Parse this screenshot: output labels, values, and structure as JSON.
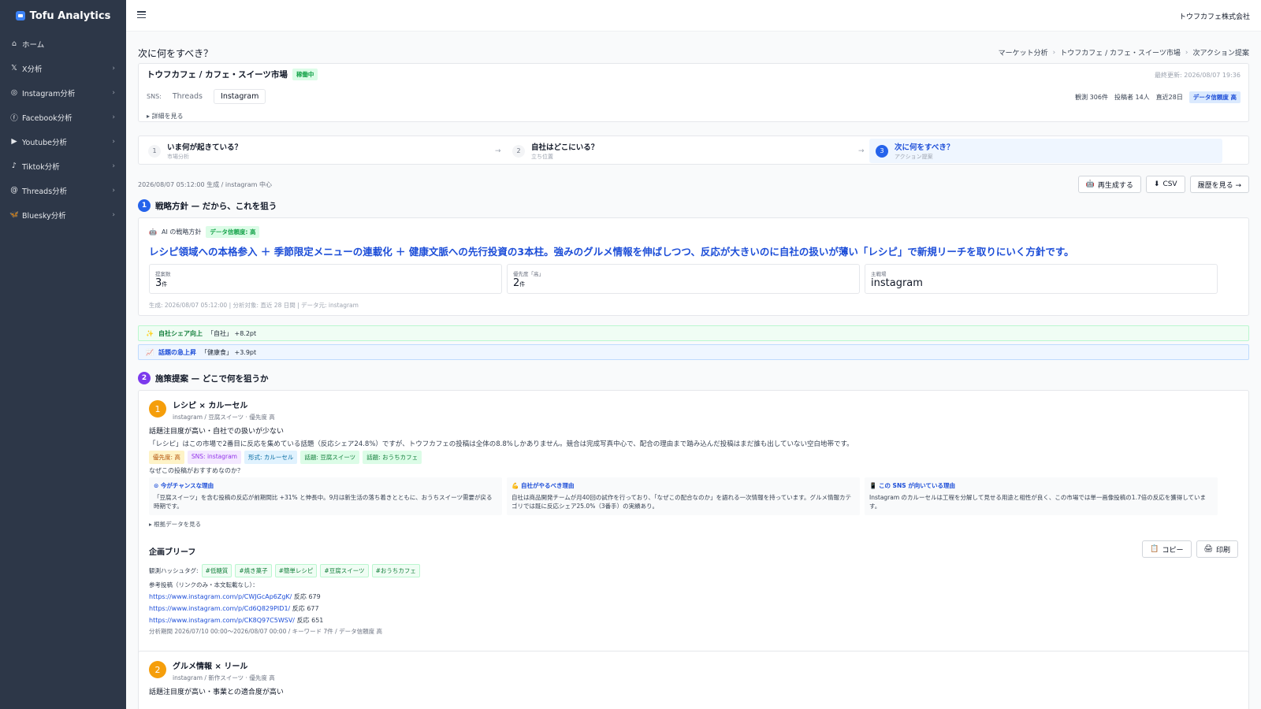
{
  "app": {
    "title": "Tofu Analytics",
    "company": "トウフカフェ株式会社"
  },
  "sidebar": {
    "items": [
      {
        "label": "ホーム",
        "icon": "home-icon",
        "chev": false
      },
      {
        "label": "X分析",
        "icon": "x-logo-icon",
        "chev": true
      },
      {
        "label": "Instagram分析",
        "icon": "instagram-icon",
        "chev": true
      },
      {
        "label": "Facebook分析",
        "icon": "facebook-icon",
        "chev": true
      },
      {
        "label": "Youtube分析",
        "icon": "youtube-icon",
        "chev": true
      },
      {
        "label": "Tiktok分析",
        "icon": "tiktok-icon",
        "chev": true
      },
      {
        "label": "Threads分析",
        "icon": "threads-icon",
        "chev": true
      },
      {
        "label": "Bluesky分析",
        "icon": "bluesky-icon",
        "chev": true
      }
    ]
  },
  "page": {
    "title": "次に何をすべき？",
    "breadcrumb": [
      "マーケット分析",
      "トウフカフェ / カフェ・スイーツ市場",
      "次アクション提案"
    ]
  },
  "market": {
    "title": "トウフカフェ / カフェ・スイーツ市場",
    "status": "稼働中",
    "last_update": "最終更新: 2026/08/07 19:36",
    "sns_label": "SNS:",
    "sns_tabs": [
      "Threads",
      "Instagram"
    ],
    "stats": [
      "観測 306件",
      "投稿者 14人",
      "直近28日"
    ],
    "reliability": "データ信頼度 高",
    "detail_toggle": "▸ 詳細を見る"
  },
  "steps": [
    {
      "num": "1",
      "title": "いま何が起きている？",
      "sub": "市場分析"
    },
    {
      "num": "2",
      "title": "自社はどこにいる？",
      "sub": "立ち位置"
    },
    {
      "num": "3",
      "title": "次に何をすべき？",
      "sub": "アクション提案"
    }
  ],
  "gen_info": "2026/08/07 05:12:00 生成 / instagram 中心",
  "actions": {
    "regenerate": "再生成する",
    "csv": "CSV",
    "history": "履歴を見る →"
  },
  "strategy": {
    "num": "1",
    "heading": "戦略方針 — だから、これを狙う",
    "ai_label": "AI の戦略方針",
    "reliability": "データ信頼度: 高",
    "text": "レシピ領域への本格参入 ＋ 季節限定メニューの連載化 ＋ 健康文脈への先行投資の3本柱。強みのグルメ情報を伸ばしつつ、反応が大きいのに自社の扱いが薄い「レシピ」で新規リーチを取りにいく方針です。",
    "kpis": [
      {
        "label": "提案数",
        "value": "3",
        "unit": "件"
      },
      {
        "label": "優先度「高」",
        "value": "2",
        "unit": "件"
      },
      {
        "label": "主戦場",
        "value": "instagram",
        "unit": ""
      }
    ],
    "meta": "生成: 2026/08/07 05:12:00 | 分析対象: 直近 28 日間 | データ元: instagram"
  },
  "alerts": [
    {
      "icon": "✨",
      "label": "自社シェア向上",
      "text": "「自社」 +8.2pt"
    },
    {
      "icon": "📈",
      "label": "話題の急上昇",
      "text": "「健康食」 +3.9pt"
    }
  ],
  "proposals_section": {
    "num": "2",
    "heading": "施策提案 — どこで何を狙うか"
  },
  "proposal1": {
    "num": "1",
    "title": "レシピ × カルーセル",
    "sub": "instagram / 豆腐スイーツ · 優先度 高",
    "headline": "話題注目度が高い・自社での扱いが少ない",
    "body": "「レシピ」はこの市場で2番目に反応を集めている話題（反応シェア24.8%）ですが、トウフカフェの投稿は全体の8.8%しかありません。競合は完成写真中心で、配合の理由まで踏み込んだ投稿はまだ誰も出していない空白地帯です。",
    "tags": [
      {
        "text": "優先度: 高",
        "bg": "#fef3c7",
        "fg": "#b45309"
      },
      {
        "text": "SNS: instagram",
        "bg": "#f3e8ff",
        "fg": "#9333ea"
      },
      {
        "text": "形式: カルーセル",
        "bg": "#e0f2fe",
        "fg": "#0369a1"
      },
      {
        "text": "話題: 豆腐スイーツ",
        "bg": "#dcfce7",
        "fg": "#15803d"
      },
      {
        "text": "話題: おうちカフェ",
        "bg": "#dcfce7",
        "fg": "#15803d"
      }
    ],
    "why_title": "なぜこの投稿がおすすめなのか？",
    "reasons": [
      {
        "title": "⊙ 今がチャンスな理由",
        "body": "「豆腐スイーツ」を含む投稿の反応が前期間比 +31% と伸長中。9月は新生活の落ち着きとともに、おうちスイーツ需要が戻る時期です。"
      },
      {
        "title": "💪 自社がやるべき理由",
        "body": "自社は商品開発チームが月40回の試作を行っており、「なぜこの配合なのか」を語れる一次情報を持っています。グルメ情報カテゴリでは既に反応シェア25.0%（3番手）の実績あり。"
      },
      {
        "title": "📱 この SNS が向いている理由",
        "body": "Instagram のカルーセルは工程を分解して見せる用途と相性が良く、この市場では単一画像投稿の1.7倍の反応を獲得しています。"
      }
    ],
    "basis_toggle": "▸ 根拠データを見る",
    "brief": {
      "title": "企画ブリーフ",
      "copy": "コピー",
      "print": "印刷",
      "hashtag_label": "観測ハッシュタグ:",
      "hashtags": [
        "#低糖質",
        "#焼き菓子",
        "#簡単レシピ",
        "#豆腐スイーツ",
        "#おうちカフェ"
      ],
      "ref_label": "参考投稿（リンクのみ・本文転載なし）：",
      "refs": [
        {
          "url": "https://www.instagram.com/p/CWJGcAp6ZgK/",
          "note": "反応 679"
        },
        {
          "url": "https://www.instagram.com/p/Cd6Q829PID1/",
          "note": "反応 677"
        },
        {
          "url": "https://www.instagram.com/p/CK8Q97C5WSV/",
          "note": "反応 651"
        }
      ],
      "meta": "分析期間 2026/07/10 00:00〜2026/08/07 00:00 / キーワード 7件 / データ信頼度 高"
    }
  },
  "proposal2": {
    "num": "2",
    "title": "グルメ情報 × リール",
    "sub": "instagram / 新作スイーツ · 優先度 高",
    "headline": "話題注目度が高い・事業との適合度が高い"
  },
  "colors": {
    "sidebar": "#2d3748",
    "accent": "#2563eb",
    "purple": "#7c3aed",
    "orange": "#f59e0b"
  }
}
